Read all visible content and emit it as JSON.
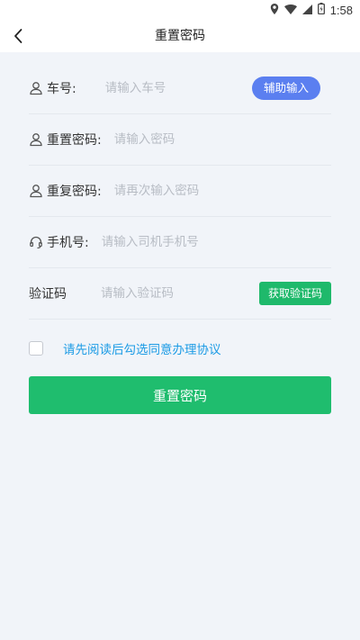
{
  "status_bar": {
    "time": "1:58"
  },
  "app_bar": {
    "title": "重置密码"
  },
  "form": {
    "car_number": {
      "label": "车号:",
      "placeholder": "请输入车号",
      "assist_label": "辅助输入"
    },
    "password": {
      "label": "重置密码:",
      "placeholder": "请输入密码"
    },
    "confirm_password": {
      "label": "重复密码:",
      "placeholder": "请再次输入密码"
    },
    "phone": {
      "label": "手机号:",
      "placeholder": "请输入司机手机号"
    },
    "code": {
      "label": "验证码",
      "placeholder": "请输入验证码",
      "button_label": "获取验证码"
    }
  },
  "agreement": {
    "text": "请先阅读后勾选同意办理协议",
    "checked": false
  },
  "submit_label": "重置密码",
  "colors": {
    "background": "#f1f4f9",
    "assist_button": "#5b7ff0",
    "primary_green": "#1fbd6e",
    "link_blue": "#1c9be5"
  }
}
